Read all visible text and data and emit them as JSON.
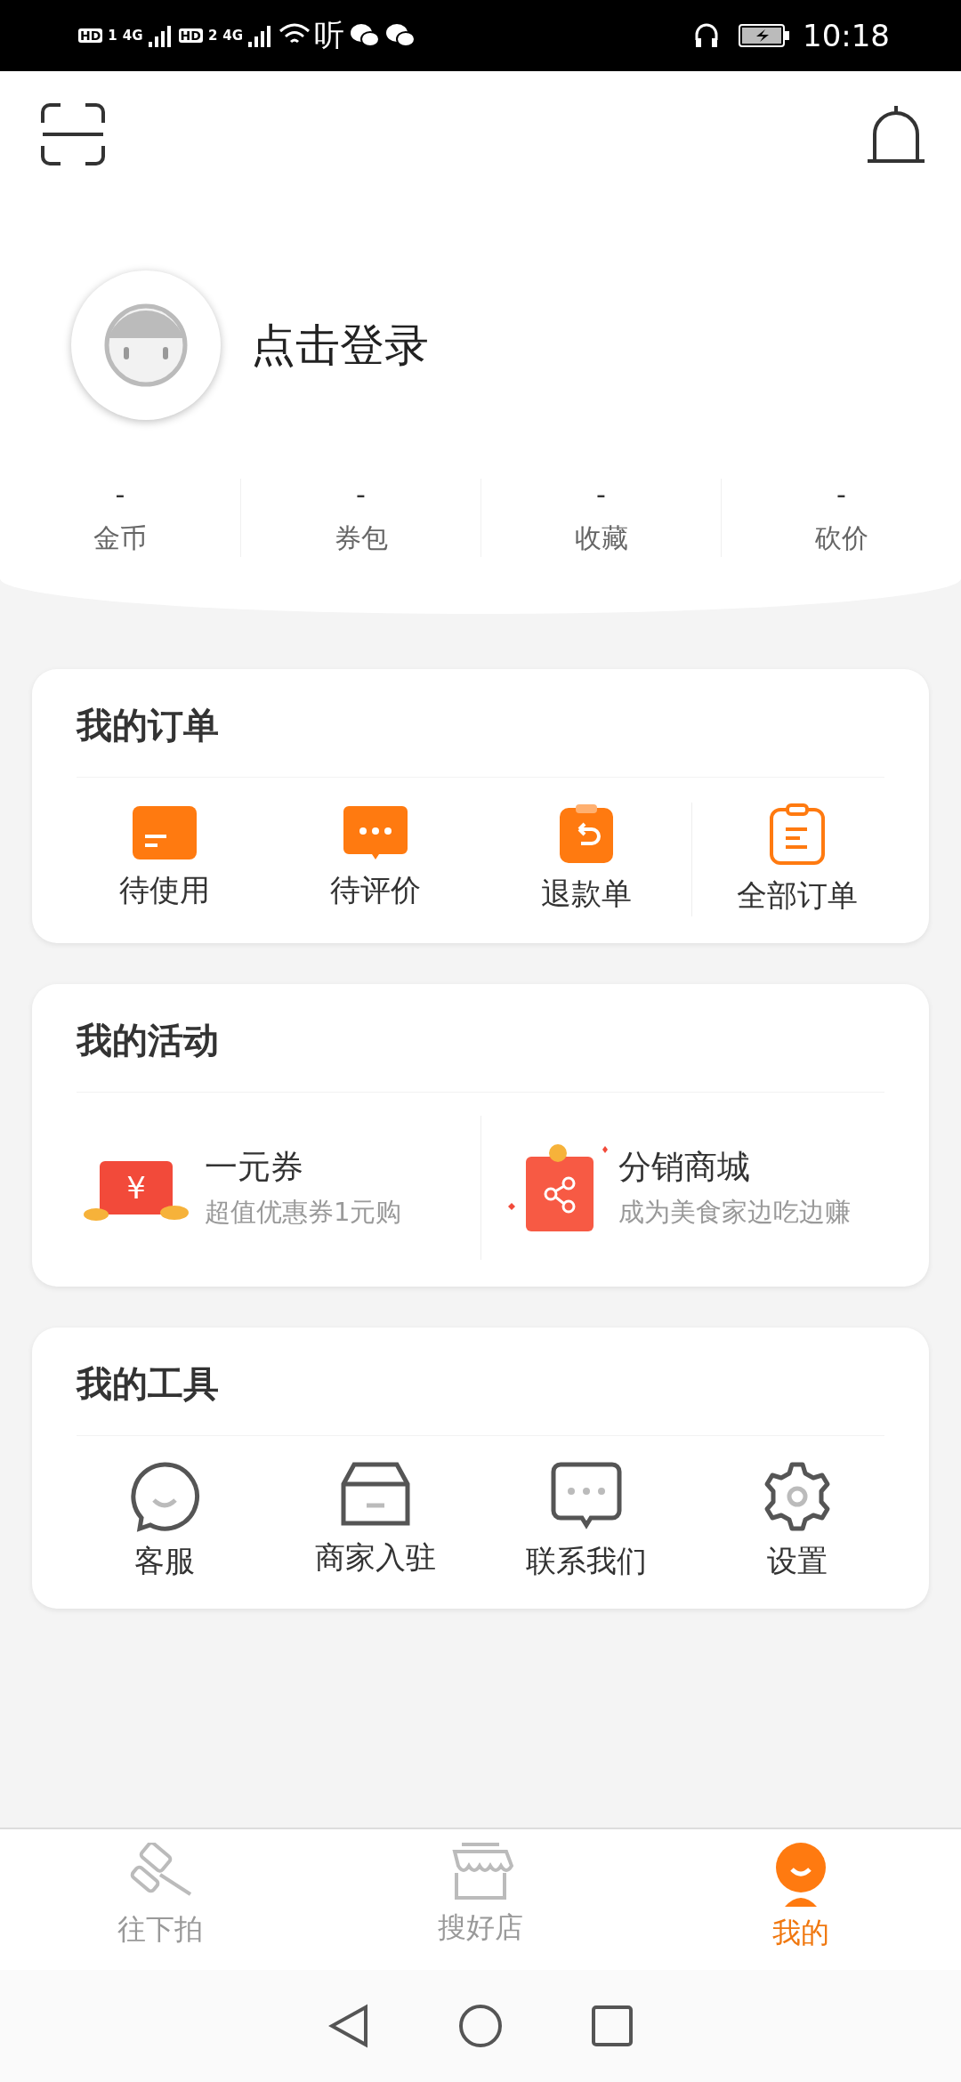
{
  "status_bar": {
    "sims": [
      {
        "badge": "HD",
        "slot": "1",
        "network": "4G"
      },
      {
        "badge": "HD",
        "slot": "2",
        "network": "4G"
      }
    ],
    "app_glyph": "听",
    "time": "10:18"
  },
  "profile": {
    "login_text": "点击登录"
  },
  "stats": [
    {
      "value": "-",
      "label": "金币"
    },
    {
      "value": "-",
      "label": "券包"
    },
    {
      "value": "-",
      "label": "收藏"
    },
    {
      "value": "-",
      "label": "砍价"
    }
  ],
  "orders": {
    "title": "我的订单",
    "items": [
      {
        "label": "待使用"
      },
      {
        "label": "待评价"
      },
      {
        "label": "退款单"
      },
      {
        "label": "全部订单"
      }
    ]
  },
  "activities": {
    "title": "我的活动",
    "items": [
      {
        "title": "一元券",
        "subtitle": "超值优惠券1元购",
        "coupon_symbol": "¥"
      },
      {
        "title": "分销商城",
        "subtitle": "成为美食家边吃边赚"
      }
    ]
  },
  "tools": {
    "title": "我的工具",
    "items": [
      {
        "label": "客服"
      },
      {
        "label": "商家入驻"
      },
      {
        "label": "联系我们"
      },
      {
        "label": "设置"
      }
    ]
  },
  "tabs": [
    {
      "label": "往下拍",
      "selected": false
    },
    {
      "label": "搜好店",
      "selected": false
    },
    {
      "label": "我的",
      "selected": true
    }
  ]
}
